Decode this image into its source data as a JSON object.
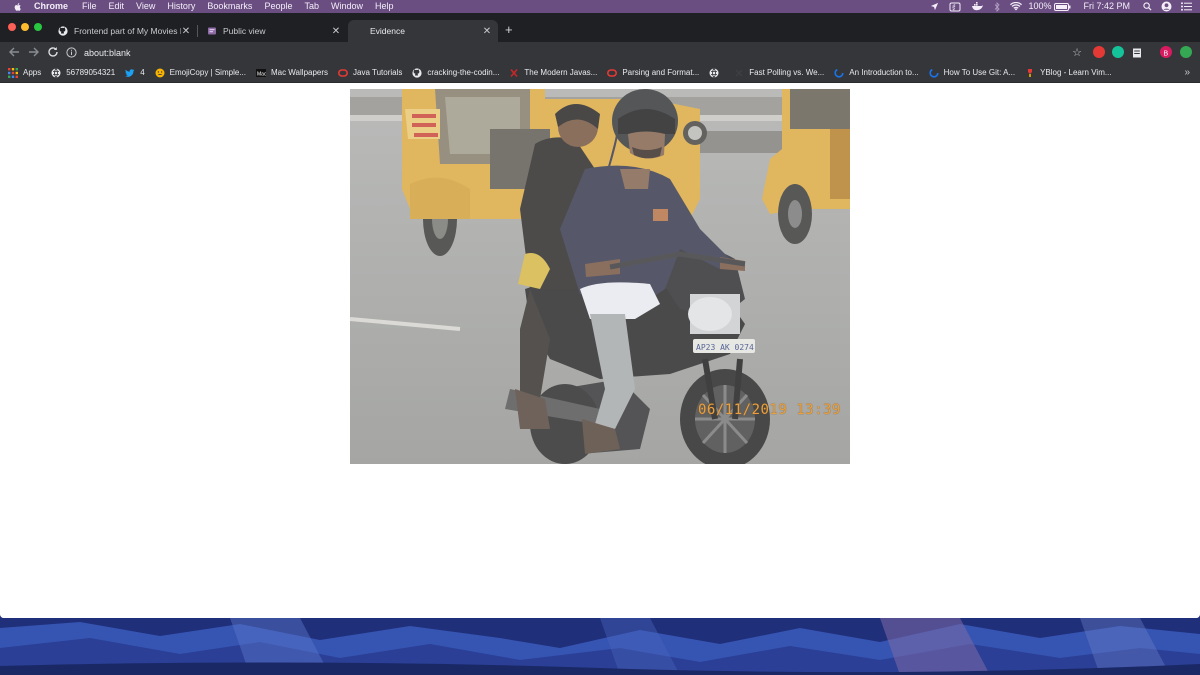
{
  "menubar": {
    "apple_icon": "apple-icon",
    "app_name": "Chrome",
    "items": [
      "File",
      "Edit",
      "View",
      "History",
      "Bookmarks",
      "People",
      "Tab",
      "Window",
      "Help"
    ],
    "battery": "100%",
    "clock": "Fri 7:42 PM"
  },
  "tabs": [
    {
      "title": "Frontend part of My Movies Data",
      "icon": "github-icon",
      "active": false
    },
    {
      "title": "Public view",
      "icon": "page-icon",
      "active": false
    },
    {
      "title": "Evidence",
      "icon": "",
      "active": true
    }
  ],
  "newtab_label": "+",
  "address": {
    "url": "about:blank"
  },
  "bookmarks": [
    {
      "label": "Apps",
      "icon": "apps-grid-icon",
      "color": "#ea4335"
    },
    {
      "label": "56789054321",
      "icon": "globe-icon",
      "color": "#e8eaed"
    },
    {
      "label": "4",
      "icon": "twitter-icon",
      "color": "#1da1f2"
    },
    {
      "label": "EmojiCopy | Simple...",
      "icon": "emoji-icon",
      "color": "#f4b400"
    },
    {
      "label": "Mac Wallpapers",
      "icon": "mac-icon",
      "color": "#000000"
    },
    {
      "label": "Java Tutorials",
      "icon": "oracle-icon",
      "color": "#e53935"
    },
    {
      "label": "cracking-the-codin...",
      "icon": "github-icon",
      "color": "#e8eaed"
    },
    {
      "label": "The Modern Javas...",
      "icon": "x-icon",
      "color": "#c62828"
    },
    {
      "label": "Parsing and Format...",
      "icon": "oracle-icon",
      "color": "#e53935"
    },
    {
      "label": "",
      "icon": "globe-icon",
      "color": "#e8eaed"
    },
    {
      "label": "Fast Polling vs. We...",
      "icon": "dot-icon",
      "color": "#3c4043"
    },
    {
      "label": "An Introduction to...",
      "icon": "spinner-icon",
      "color": "#1a73e8"
    },
    {
      "label": "How To Use Git: A...",
      "icon": "spinner-icon",
      "color": "#1a73e8"
    },
    {
      "label": "YBlog - Learn Vim...",
      "icon": "ybrand-icon",
      "color": "#e53935"
    }
  ],
  "bookmarks_overflow": "»",
  "photo": {
    "timestamp": "06/11/2019  13:39",
    "plate": "AP23   AK   0274"
  },
  "colors": {
    "menubar": "#6a4e82",
    "tabstrip": "#1f2023",
    "toolbar": "#35363a",
    "page": "#ffffff"
  }
}
